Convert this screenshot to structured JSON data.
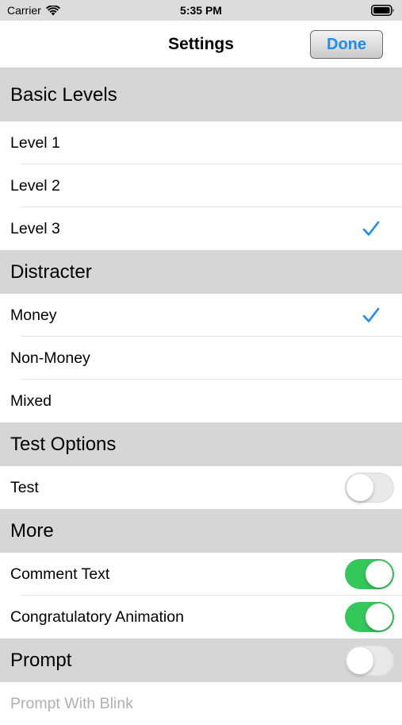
{
  "status_bar": {
    "carrier": "Carrier",
    "time": "5:35 PM",
    "icons": [
      "wifi-icon",
      "battery-icon"
    ]
  },
  "nav": {
    "title": "Settings",
    "done_label": "Done"
  },
  "colors": {
    "accent": "#1e8cf0",
    "toggle_on": "#34c759",
    "section_bg": "#d6d6d6"
  },
  "sections": {
    "basic_levels": {
      "title": "Basic Levels",
      "rows": [
        {
          "label": "Level 1",
          "checked": false
        },
        {
          "label": "Level 2",
          "checked": false
        },
        {
          "label": "Level 3",
          "checked": true
        }
      ]
    },
    "distracter": {
      "title": "Distracter",
      "rows": [
        {
          "label": "Money",
          "checked": true
        },
        {
          "label": "Non-Money",
          "checked": false
        },
        {
          "label": "Mixed",
          "checked": false
        }
      ]
    },
    "test_options": {
      "title": "Test Options",
      "rows": [
        {
          "label": "Test",
          "toggle": false
        }
      ]
    },
    "more": {
      "title": "More",
      "rows": [
        {
          "label": "Comment Text",
          "toggle": true
        },
        {
          "label": "Congratulatory Animation",
          "toggle": true
        }
      ]
    },
    "prompt": {
      "title": "Prompt",
      "toggle": false,
      "rows": [
        {
          "label": "Prompt With Blink",
          "enabled": false
        }
      ]
    }
  }
}
